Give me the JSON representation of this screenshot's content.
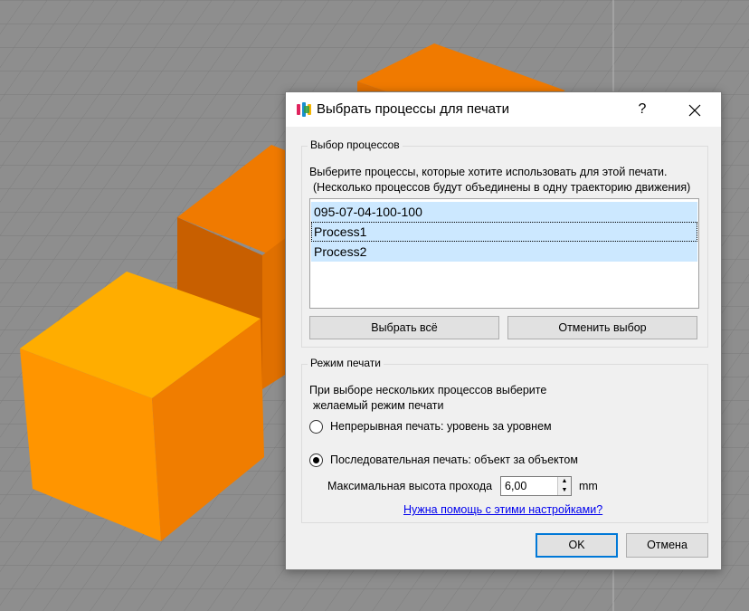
{
  "dialog": {
    "title": "Выбрать процессы для печати",
    "help_label": "?",
    "icons": {
      "app": "app-logo-icon",
      "close": "close-icon"
    }
  },
  "process_group": {
    "title": "Выбор процессов",
    "description_line1": "Выберите процессы, которые хотите использовать для этой печати.",
    "description_line2": "(Несколько процессов будут объединены в одну траекторию движения)",
    "items": [
      {
        "label": "095-07-04-100-100",
        "selected": true
      },
      {
        "label": "Process1",
        "selected": true,
        "focused": true
      },
      {
        "label": "Process2",
        "selected": true
      }
    ],
    "select_all_label": "Выбрать всё",
    "deselect_label": "Отменить выбор"
  },
  "print_mode_group": {
    "title": "Режим печати",
    "description_line1": "При выборе нескольких процессов выберите",
    "description_line2": "желаемый режим печати",
    "options": [
      {
        "label": "Непрерывная печать: уровень за уровнем",
        "checked": false
      },
      {
        "label": "Последовательная печать: объект за объектом",
        "checked": true
      }
    ],
    "max_height_label": "Максимальная высота прохода",
    "max_height_value": "6,00",
    "max_height_unit": "mm",
    "help_link": "Нужна помощь с этими настройками?"
  },
  "footer": {
    "ok_label": "OK",
    "cancel_label": "Отмена"
  },
  "colors": {
    "accent": "#0078d7",
    "selection": "#cce8ff",
    "cube_orange": "#f08000",
    "viewport_bg": "#8e8e8e"
  }
}
